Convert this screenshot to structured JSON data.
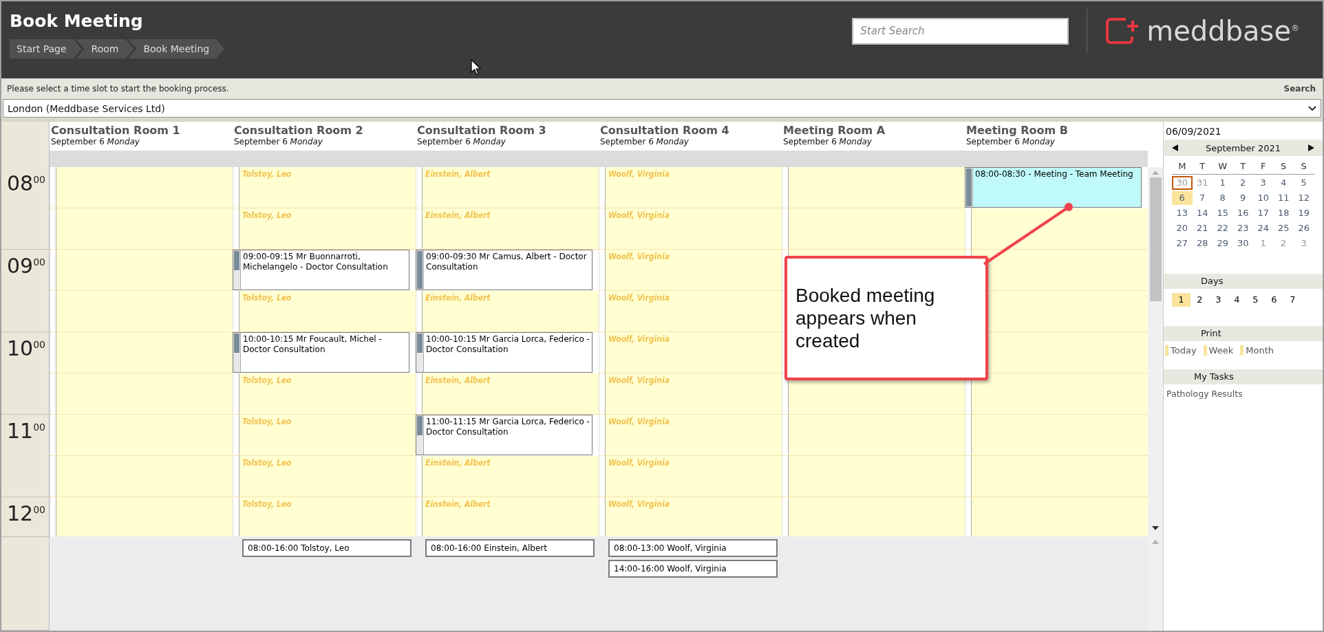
{
  "header": {
    "title": "Book Meeting",
    "breadcrumbs": [
      "Start Page",
      "Room",
      "Book Meeting"
    ],
    "search": {
      "placeholder": "Start Search"
    },
    "logo": "meddbase$^{®}$"
  },
  "info_bar": {
    "message": "Please select a time slot to start the booking process.",
    "search_link": "Search"
  },
  "location_select": {
    "value": "London (Meddbase Services Ltd)"
  },
  "schedule": {
    "hours": [
      "08$^{00}$",
      "09$^{00}$",
      "10$^{00}$",
      "11$^{00}$",
      "12$^{00}$"
    ],
    "columns": [
      {
        "name": "Consultation Room 1",
        "date": "September 6 *Monday*",
        "slots": [
          {
            "kind": "open"
          },
          {
            "kind": "open"
          },
          {
            "kind": "open"
          },
          {
            "kind": "open"
          },
          {
            "kind": "open"
          },
          {
            "kind": "open"
          },
          {
            "kind": "open"
          },
          {
            "kind": "open"
          },
          {
            "kind": "open"
          }
        ]
      },
      {
        "name": "Consultation Room 2",
        "date": "September 6 *Monday*",
        "slots": [
          {
            "kind": "available",
            "provider": "Tolstoy, Leo"
          },
          {
            "kind": "available",
            "provider": "Tolstoy, Leo"
          },
          {
            "kind": "appointment",
            "text": "09:00-09:15 Mr Buonnarroti, Michelangelo - Doctor Consultation",
            "level": 0.5
          },
          {
            "kind": "available",
            "provider": "Tolstoy, Leo"
          },
          {
            "kind": "appointment",
            "text": "10:00-10:15 Mr Foucault, Michel - Doctor Consultation",
            "level": 0.5
          },
          {
            "kind": "available",
            "provider": "Tolstoy, Leo"
          },
          {
            "kind": "available",
            "provider": "Tolstoy, Leo"
          },
          {
            "kind": "available",
            "provider": "Tolstoy, Leo"
          },
          {
            "kind": "available",
            "provider": "Tolstoy, Leo"
          }
        ],
        "sessions": [
          "08:00-16:00 Tolstoy, Leo"
        ]
      },
      {
        "name": "Consultation Room 3",
        "date": "September 6 *Monday*",
        "slots": [
          {
            "kind": "available",
            "provider": "Einstein, Albert"
          },
          {
            "kind": "available",
            "provider": "Einstein, Albert"
          },
          {
            "kind": "appointment",
            "text": "09:00-09:30 Mr Camus, Albert - Doctor Consultation",
            "level": 1
          },
          {
            "kind": "available",
            "provider": "Einstein, Albert"
          },
          {
            "kind": "appointment",
            "text": "10:00-10:15 Mr Garcia Lorca, Federico - Doctor Consultation",
            "level": 0.5
          },
          {
            "kind": "available",
            "provider": "Einstein, Albert"
          },
          {
            "kind": "appointment",
            "text": "11:00-11:15 Mr Garcia Lorca, Federico - Doctor Consultation",
            "level": 0.5
          },
          {
            "kind": "available",
            "provider": "Einstein, Albert"
          },
          {
            "kind": "available",
            "provider": "Einstein, Albert"
          }
        ],
        "sessions": [
          "08:00-16:00 Einstein, Albert"
        ]
      },
      {
        "name": "Consultation Room 4",
        "date": "September 6 *Monday*",
        "slots": [
          {
            "kind": "available",
            "provider": "Woolf, Virginia"
          },
          {
            "kind": "available",
            "provider": "Woolf, Virginia"
          },
          {
            "kind": "available",
            "provider": "Woolf, Virginia"
          },
          {
            "kind": "available",
            "provider": "Woolf, Virginia"
          },
          {
            "kind": "available",
            "provider": "Woolf, Virginia"
          },
          {
            "kind": "available",
            "provider": "Woolf, Virginia"
          },
          {
            "kind": "available",
            "provider": "Woolf, Virginia"
          },
          {
            "kind": "available",
            "provider": "Woolf, Virginia"
          },
          {
            "kind": "available",
            "provider": "Woolf, Virginia"
          }
        ],
        "sessions": [
          "08:00-13:00 Woolf, Virginia",
          "14:00-16:00 Woolf, Virginia"
        ]
      },
      {
        "name": "Meeting Room A",
        "date": "September 6 *Monday*",
        "slots": [
          {
            "kind": "open"
          },
          {
            "kind": "open"
          },
          {
            "kind": "open"
          },
          {
            "kind": "open"
          },
          {
            "kind": "open"
          },
          {
            "kind": "open"
          },
          {
            "kind": "open"
          },
          {
            "kind": "open"
          },
          {
            "kind": "open"
          }
        ]
      },
      {
        "name": "Meeting Room B",
        "date": "September 6 *Monday*",
        "slots": [
          {
            "kind": "meeting",
            "text": "08:00-08:30 - Meeting - Team Meeting",
            "level": 1
          },
          {
            "kind": "open"
          },
          {
            "kind": "open"
          },
          {
            "kind": "open"
          },
          {
            "kind": "open"
          },
          {
            "kind": "open"
          },
          {
            "kind": "open"
          },
          {
            "kind": "open"
          },
          {
            "kind": "open"
          }
        ]
      }
    ]
  },
  "callout": {
    "text": "Booked meeting appears when created"
  },
  "sidebar": {
    "date": "06/09/2021",
    "month": "September 2021",
    "weekdays": [
      "M",
      "T",
      "W",
      "T",
      "F",
      "S",
      "S"
    ],
    "days": [
      {
        "label": "30",
        "in_month": false,
        "selected": false,
        "today": true
      },
      {
        "label": "31",
        "in_month": false,
        "selected": false,
        "today": false
      },
      {
        "label": "1",
        "in_month": true,
        "selected": false,
        "today": false
      },
      {
        "label": "2",
        "in_month": true,
        "selected": false,
        "today": false
      },
      {
        "label": "3",
        "in_month": true,
        "selected": false,
        "today": false
      },
      {
        "label": "4",
        "in_month": true,
        "selected": false,
        "today": false
      },
      {
        "label": "5",
        "in_month": true,
        "selected": false,
        "today": false
      },
      {
        "label": "6",
        "in_month": true,
        "selected": true,
        "today": false
      },
      {
        "label": "7",
        "in_month": true,
        "selected": false,
        "today": false
      },
      {
        "label": "8",
        "in_month": true,
        "selected": false,
        "today": false
      },
      {
        "label": "9",
        "in_month": true,
        "selected": false,
        "today": false
      },
      {
        "label": "10",
        "in_month": true,
        "selected": false,
        "today": false
      },
      {
        "label": "11",
        "in_month": true,
        "selected": false,
        "today": false
      },
      {
        "label": "12",
        "in_month": true,
        "selected": false,
        "today": false
      },
      {
        "label": "13",
        "in_month": true,
        "selected": false,
        "today": false
      },
      {
        "label": "14",
        "in_month": true,
        "selected": false,
        "today": false
      },
      {
        "label": "15",
        "in_month": true,
        "selected": false,
        "today": false
      },
      {
        "label": "16",
        "in_month": true,
        "selected": false,
        "today": false
      },
      {
        "label": "17",
        "in_month": true,
        "selected": false,
        "today": false
      },
      {
        "label": "18",
        "in_month": true,
        "selected": false,
        "today": false
      },
      {
        "label": "19",
        "in_month": true,
        "selected": false,
        "today": false
      },
      {
        "label": "20",
        "in_month": true,
        "selected": false,
        "today": false
      },
      {
        "label": "21",
        "in_month": true,
        "selected": false,
        "today": false
      },
      {
        "label": "22",
        "in_month": true,
        "selected": false,
        "today": false
      },
      {
        "label": "23",
        "in_month": true,
        "selected": false,
        "today": false
      },
      {
        "label": "24",
        "in_month": true,
        "selected": false,
        "today": false
      },
      {
        "label": "25",
        "in_month": true,
        "selected": false,
        "today": false
      },
      {
        "label": "26",
        "in_month": true,
        "selected": false,
        "today": false
      },
      {
        "label": "27",
        "in_month": true,
        "selected": false,
        "today": false
      },
      {
        "label": "28",
        "in_month": true,
        "selected": false,
        "today": false
      },
      {
        "label": "29",
        "in_month": true,
        "selected": false,
        "today": false
      },
      {
        "label": "30",
        "in_month": true,
        "selected": false,
        "today": false
      },
      {
        "label": "1",
        "in_month": false,
        "selected": false,
        "today": false
      },
      {
        "label": "2",
        "in_month": false,
        "selected": false,
        "today": false
      },
      {
        "label": "3",
        "in_month": false,
        "selected": false,
        "today": false
      }
    ],
    "days_heading": "Days",
    "day_counts": [
      {
        "label": "1",
        "selected": true
      },
      {
        "label": "2",
        "selected": false
      },
      {
        "label": "3",
        "selected": false
      },
      {
        "label": "4",
        "selected": false
      },
      {
        "label": "5",
        "selected": false
      },
      {
        "label": "6",
        "selected": false
      },
      {
        "label": "7",
        "selected": false
      }
    ],
    "print_heading": "Print",
    "print_options": [
      "Today",
      "Week",
      "Month"
    ],
    "tasks_heading": "My Tasks",
    "tasks": [
      "Pathology Results"
    ]
  }
}
